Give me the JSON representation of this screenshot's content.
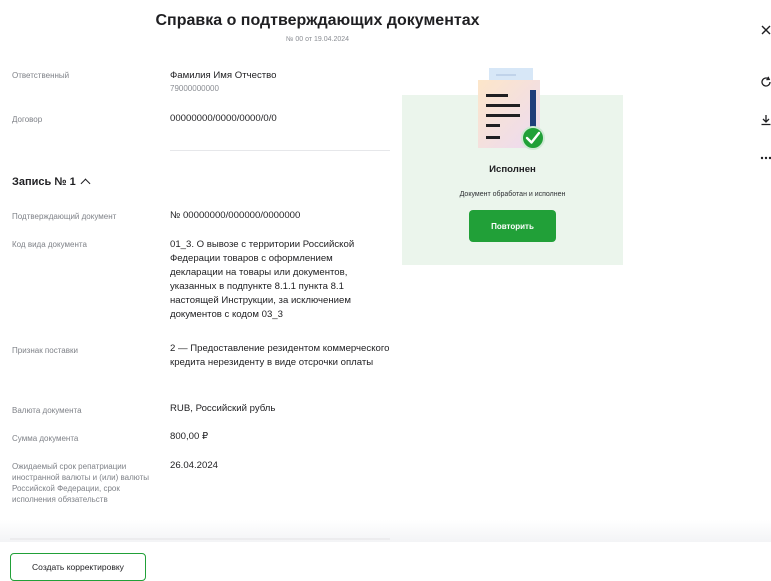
{
  "header": {
    "title": "Справка о подтверждающих документах",
    "subtitle": "№ 00 от 19.04.2024"
  },
  "info": {
    "responsible_label": "Ответственный",
    "responsible_name": "Фамилия Имя Отчество",
    "responsible_phone": "79000000000",
    "contract_label": "Договор",
    "contract_value": "00000000/0000/0000/0/0"
  },
  "record": {
    "title": "Запись № 1",
    "fields": [
      {
        "label": "Подтверждающий документ",
        "value": "№ 00000000/000000/0000000"
      },
      {
        "label": "Код вида документа",
        "value": "01_3. О вывозе с территории Российской Федерации товаров с оформлением декларации на товары или документов, указанных в подпункте 8.1.1 пункта 8.1 настоящей Инструкции, за исключением документов с кодом 03_3"
      },
      {
        "label": "Признак поставки",
        "value": "2 — Предоставление резидентом коммерческого кредита нерезиденту в виде отсрочки оплаты"
      },
      {
        "label": "Валюта документа",
        "value": "RUB, Российский рубль"
      },
      {
        "label": "Сумма документа",
        "value": "800,00 ₽"
      },
      {
        "label": "Ожидаемый срок репатриации иностранной валюты и (или) валюты Российской Федерации, срок исполнения обязательств",
        "value": "26.04.2024"
      }
    ]
  },
  "status_card": {
    "status": "Исполнен",
    "description": "Документ обработан и исполнен",
    "button_label": "Повторить"
  },
  "actions": {
    "create_correction_label": "Создать корректировку"
  },
  "side_icons": [
    "close-icon",
    "refresh-icon",
    "download-icon",
    "more-icon"
  ],
  "colors": {
    "accent": "#21a038",
    "card_bg": "#ebf5ec",
    "label_gray": "#7f8288"
  }
}
